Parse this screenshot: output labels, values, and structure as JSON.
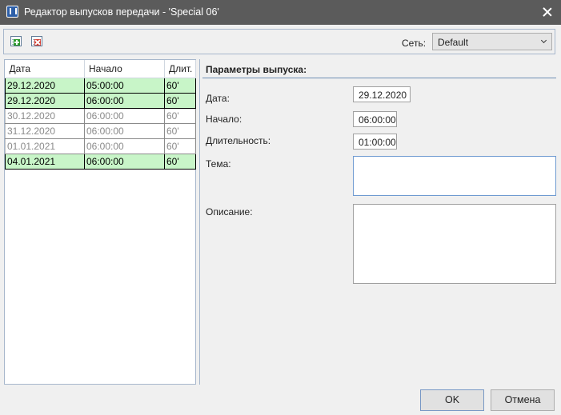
{
  "window": {
    "title": "Редактор выпусков передачи - 'Special 06'"
  },
  "toolbar": {
    "network_label": "Сеть:",
    "network_value": "Default"
  },
  "list": {
    "columns": [
      "Дата",
      "Начало",
      "Длит."
    ],
    "rows": [
      {
        "date": "29.12.2020",
        "start": "05:00:00",
        "duration": "60'",
        "active": true
      },
      {
        "date": "29.12.2020",
        "start": "06:00:00",
        "duration": "60'",
        "active": true
      },
      {
        "date": "30.12.2020",
        "start": "06:00:00",
        "duration": "60'",
        "active": false
      },
      {
        "date": "31.12.2020",
        "start": "06:00:00",
        "duration": "60'",
        "active": false
      },
      {
        "date": "01.01.2021",
        "start": "06:00:00",
        "duration": "60'",
        "active": false
      },
      {
        "date": "04.01.2021",
        "start": "06:00:00",
        "duration": "60'",
        "active": true
      }
    ]
  },
  "params": {
    "header": "Параметры выпуска:",
    "date_label": "Дата:",
    "date_value": "29.12.2020",
    "start_label": "Начало:",
    "start_value": "06:00:00",
    "duration_label": "Длительность:",
    "duration_value": "01:00:00",
    "topic_label": "Тема:",
    "topic_value": "",
    "description_label": "Описание:",
    "description_value": ""
  },
  "buttons": {
    "ok": "OK",
    "cancel": "Отмена"
  },
  "icons": {
    "add": "add-row-icon",
    "delete": "delete-row-icon",
    "close": "close-icon",
    "app": "app-icon"
  }
}
